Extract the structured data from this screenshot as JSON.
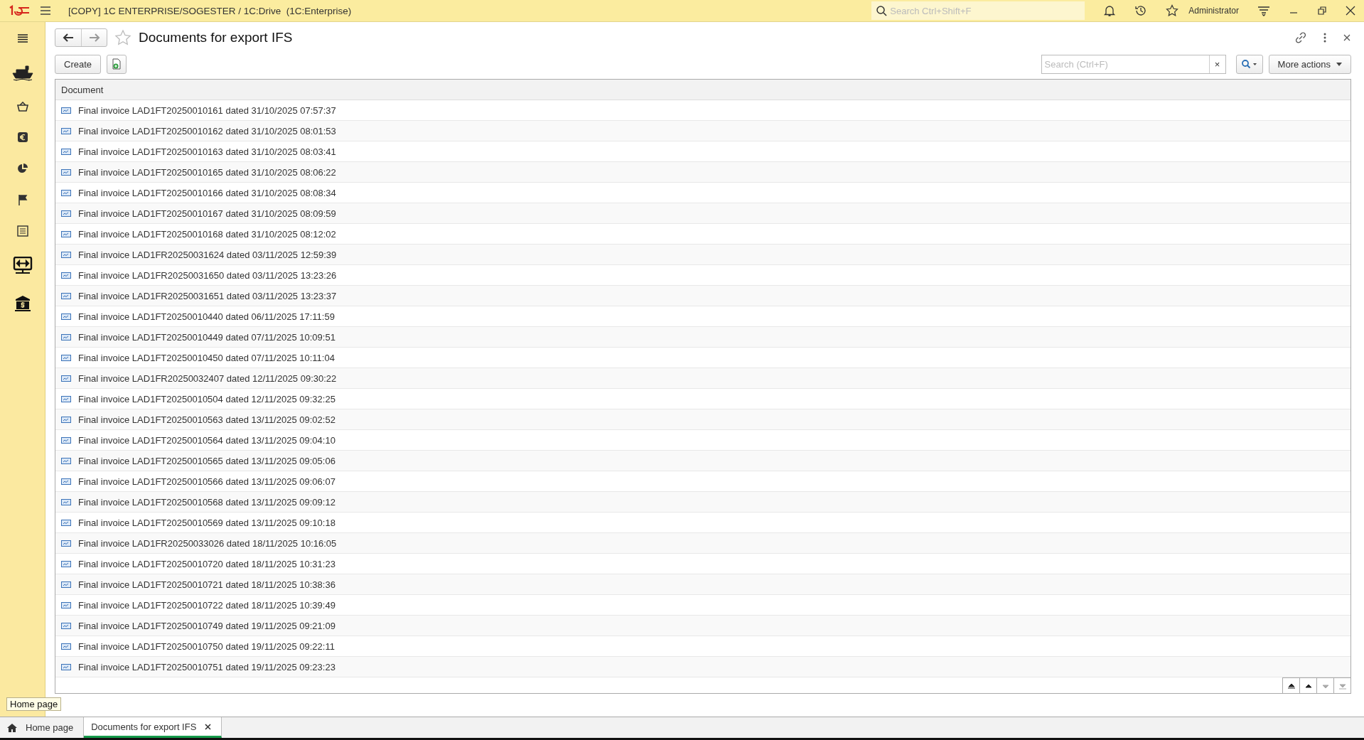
{
  "title_bar": {
    "title": "[COPY] 1C ENTERPRISE/SOGESTER / 1C:Drive  (1C:Enterprise)",
    "search": {
      "placeholder": "Search Ctrl+Shift+F"
    },
    "user": "Administrator"
  },
  "form": {
    "title": "Documents for export IFS",
    "favorite": false,
    "commands": {
      "create": "Create",
      "search": {
        "placeholder": "Search (Ctrl+F)"
      },
      "clear": "×",
      "more_actions": "More actions"
    },
    "table": {
      "columns": [
        "Document"
      ],
      "rows": [
        "Final invoice LAD1FT20250010161 dated 31/10/2025 07:57:37",
        "Final invoice LAD1FT20250010162 dated 31/10/2025 08:01:53",
        "Final invoice LAD1FT20250010163 dated 31/10/2025 08:03:41",
        "Final invoice LAD1FT20250010165 dated 31/10/2025 08:06:22",
        "Final invoice LAD1FT20250010166 dated 31/10/2025 08:08:34",
        "Final invoice LAD1FT20250010167 dated 31/10/2025 08:09:59",
        "Final invoice LAD1FT20250010168 dated 31/10/2025 08:12:02",
        "Final invoice LAD1FR20250031624 dated 03/11/2025 12:59:39",
        "Final invoice LAD1FR20250031650 dated 03/11/2025 13:23:26",
        "Final invoice LAD1FR20250031651 dated 03/11/2025 13:23:37",
        "Final invoice LAD1FT20250010440 dated 06/11/2025 17:11:59",
        "Final invoice LAD1FT20250010449 dated 07/11/2025 10:09:51",
        "Final invoice LAD1FT20250010450 dated 07/11/2025 10:11:04",
        "Final invoice LAD1FR20250032407 dated 12/11/2025 09:30:22",
        "Final invoice LAD1FT20250010504 dated 12/11/2025 09:32:25",
        "Final invoice LAD1FT20250010563 dated 13/11/2025 09:02:52",
        "Final invoice LAD1FT20250010564 dated 13/11/2025 09:04:10",
        "Final invoice LAD1FT20250010565 dated 13/11/2025 09:05:06",
        "Final invoice LAD1FT20250010566 dated 13/11/2025 09:06:07",
        "Final invoice LAD1FT20250010568 dated 13/11/2025 09:09:12",
        "Final invoice LAD1FT20250010569 dated 13/11/2025 09:10:18",
        "Final invoice LAD1FR20250033026 dated 18/11/2025 10:16:05",
        "Final invoice LAD1FT20250010720 dated 18/11/2025 10:31:23",
        "Final invoice LAD1FT20250010721 dated 18/11/2025 10:38:36",
        "Final invoice LAD1FT20250010722 dated 18/11/2025 10:39:49",
        "Final invoice LAD1FT20250010749 dated 19/11/2025 09:21:09",
        "Final invoice LAD1FT20250010750 dated 19/11/2025 09:22:11",
        "Final invoice LAD1FT20250010751 dated 19/11/2025 09:23:23"
      ]
    },
    "list_navigation": [
      {
        "kind": "first",
        "disabled": false
      },
      {
        "kind": "previous",
        "disabled": false
      },
      {
        "kind": "next",
        "disabled": true
      },
      {
        "kind": "last",
        "disabled": true
      }
    ]
  },
  "tooltip": "Home page",
  "open_tabs": [
    {
      "kind": "home",
      "label": "Home page",
      "selected": false
    },
    {
      "kind": "form",
      "label": "Documents for export IFS",
      "selected": true
    }
  ]
}
